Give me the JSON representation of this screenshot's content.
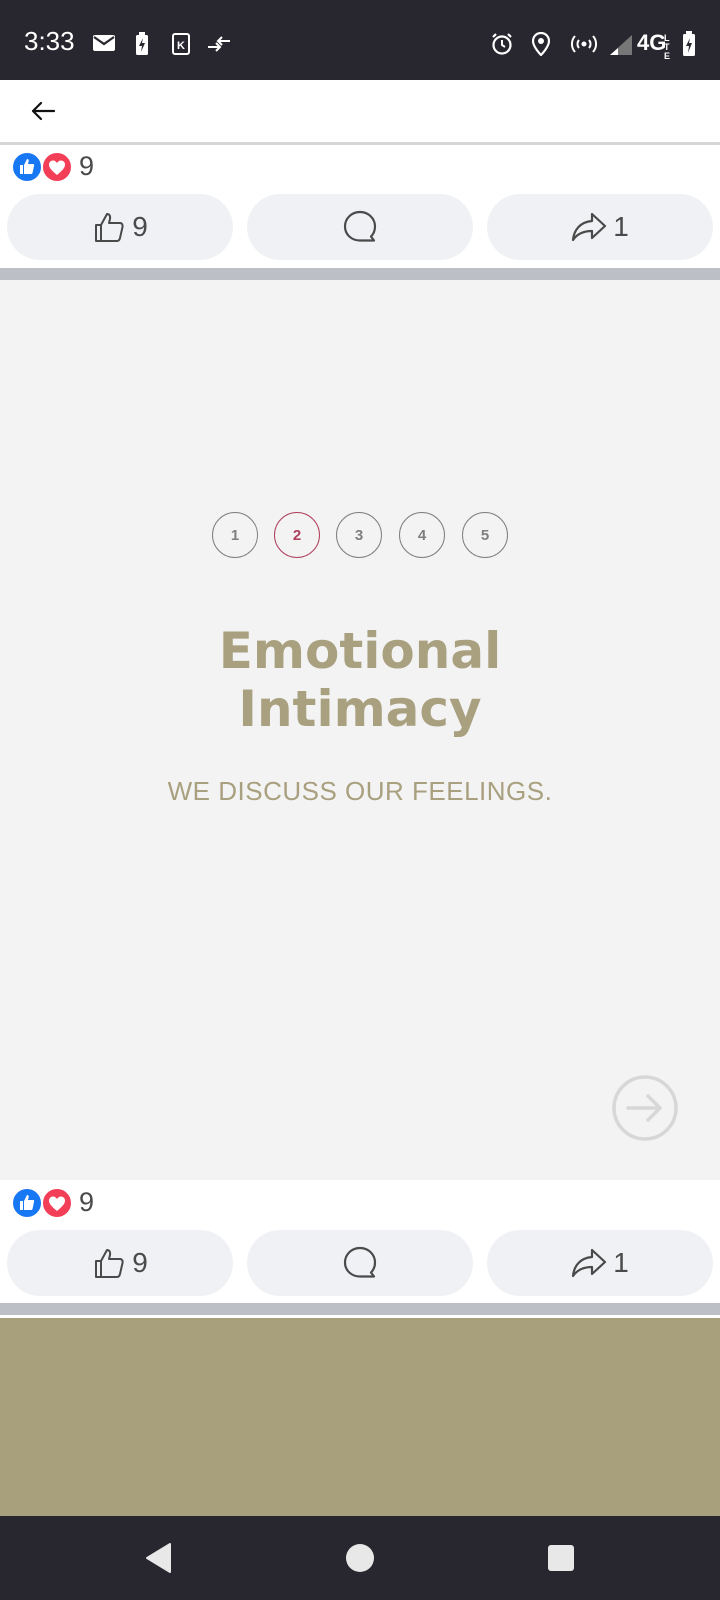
{
  "status_bar": {
    "time": "3:33",
    "network": "4G",
    "icons": [
      "mail-icon",
      "battery-saver-icon",
      "k-app-icon",
      "data-transfer-icon",
      "alarm-icon",
      "location-icon",
      "hotspot-icon",
      "signal-icon",
      "battery-icon"
    ]
  },
  "app_bar": {
    "back_icon": "arrow-left-icon"
  },
  "post_top": {
    "reaction_count": "9",
    "like_count": "9",
    "share_count": "1"
  },
  "card": {
    "steps": [
      "1",
      "2",
      "3",
      "4",
      "5"
    ],
    "active_step": "2",
    "title_line1": "Emotional",
    "title_line2": "Intimacy",
    "subtitle": "WE DISCUSS OUR FEELINGS.",
    "next_icon": "circle-arrow-right-icon"
  },
  "post_bottom": {
    "reaction_count": "9",
    "like_count": "9",
    "share_count": "1"
  },
  "colors": {
    "accent": "#a9a07f",
    "active_step": "#b0405e",
    "olive_block": "#a89f7d",
    "facebook_blue": "#1877f2",
    "love_red": "#f33e58"
  },
  "nav_bar": {
    "icons": [
      "back-triangle-icon",
      "home-circle-icon",
      "recents-square-icon"
    ]
  }
}
